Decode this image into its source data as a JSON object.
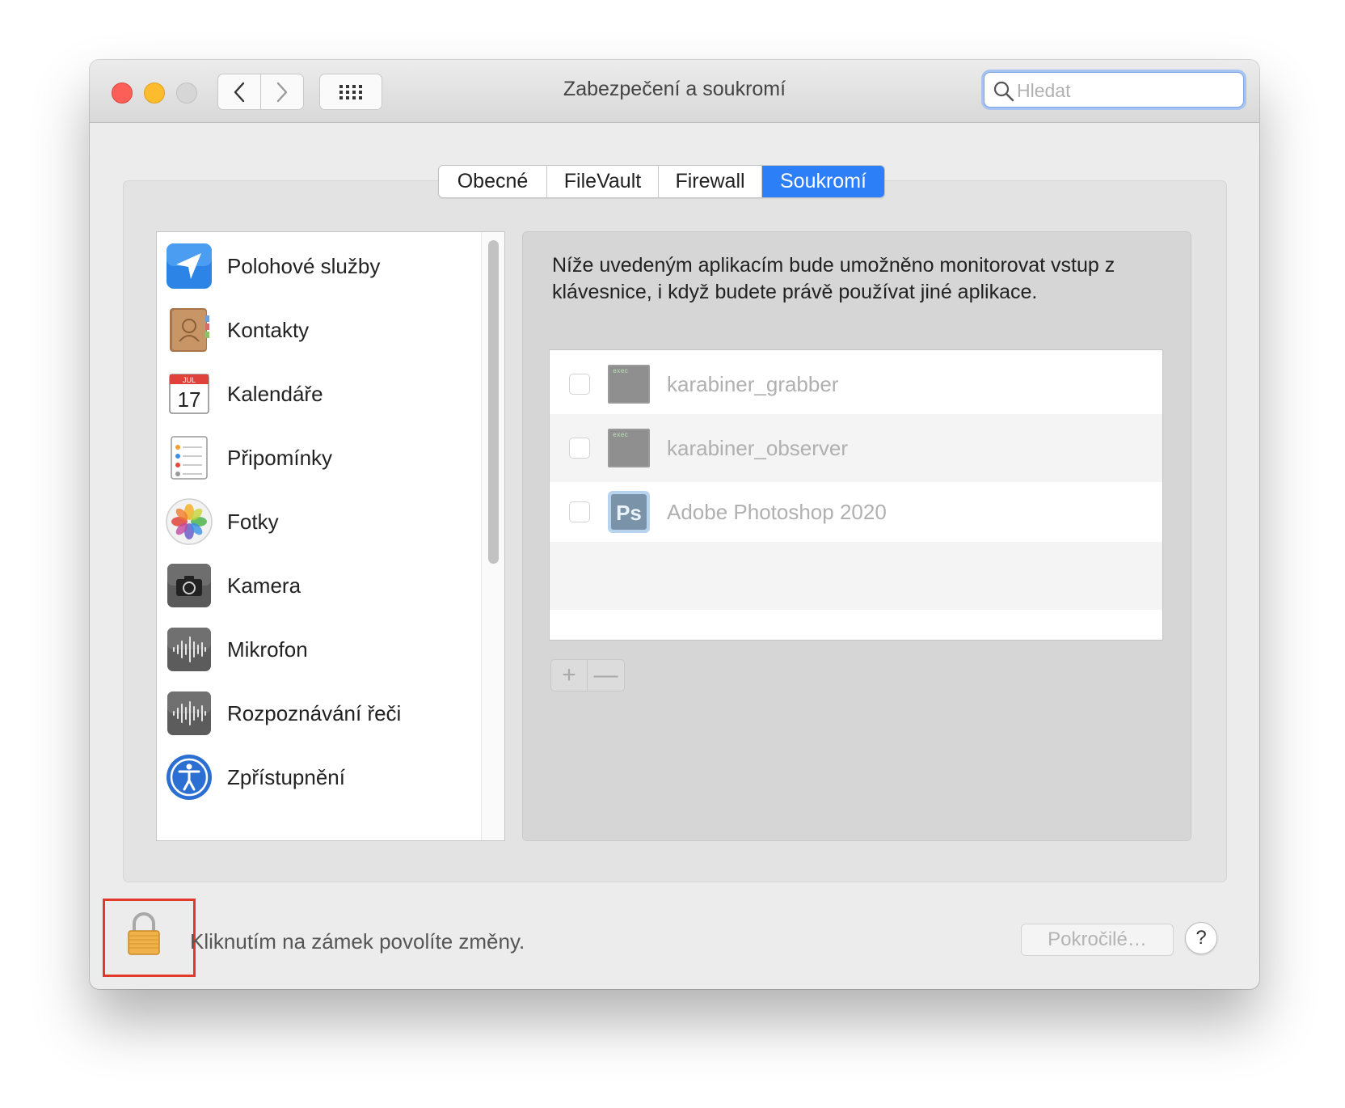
{
  "window": {
    "title": "Zabezpečení a soukromí",
    "search_placeholder": "Hledat"
  },
  "tabs": [
    {
      "label": "Obecné",
      "active": false
    },
    {
      "label": "FileVault",
      "active": false
    },
    {
      "label": "Firewall",
      "active": false
    },
    {
      "label": "Soukromí",
      "active": true
    }
  ],
  "categories": [
    {
      "label": "Polohové služby",
      "icon": "location-arrow-icon"
    },
    {
      "label": "Kontakty",
      "icon": "contacts-book-icon"
    },
    {
      "label": "Kalendáře",
      "icon": "calendar-icon",
      "icon_month": "JUL",
      "icon_day": "17"
    },
    {
      "label": "Připomínky",
      "icon": "reminders-list-icon"
    },
    {
      "label": "Fotky",
      "icon": "photos-flower-icon"
    },
    {
      "label": "Kamera",
      "icon": "camera-icon"
    },
    {
      "label": "Mikrofon",
      "icon": "microphone-waveform-icon"
    },
    {
      "label": "Rozpoznávání řeči",
      "icon": "speech-waveform-icon"
    },
    {
      "label": "Zpřístupnění",
      "icon": "accessibility-figure-icon"
    }
  ],
  "description": "Níže uvedeným aplikacím bude umožněno monitorovat vstup z klávesnice, i když budete právě používat jiné aplikace.",
  "apps": [
    {
      "name": "karabiner_grabber",
      "icon": "exec-terminal-icon",
      "icon_label": "exec",
      "checked": false
    },
    {
      "name": "karabiner_observer",
      "icon": "exec-terminal-icon",
      "icon_label": "exec",
      "checked": false
    },
    {
      "name": "Adobe Photoshop 2020",
      "icon": "photoshop-icon",
      "icon_label": "Ps",
      "checked": false
    }
  ],
  "list_controls": {
    "add": "+",
    "remove": "—"
  },
  "footer": {
    "lock_text": "Kliknutím na zámek povolíte změny.",
    "advanced_label": "Pokročilé…",
    "help_label": "?"
  },
  "colors": {
    "accent": "#2d7ff7",
    "highlight": "#e3392a",
    "lock": "#f0b04a"
  }
}
